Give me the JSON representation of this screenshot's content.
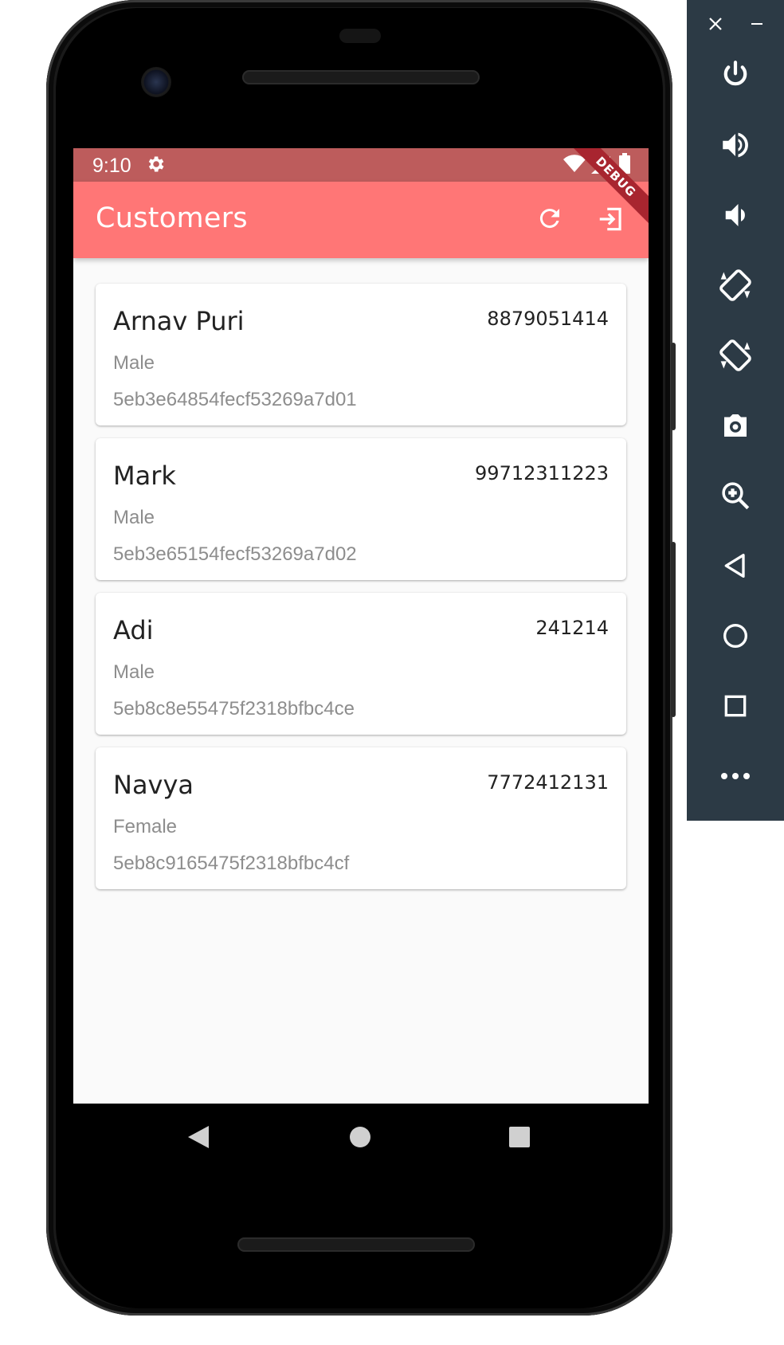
{
  "status_bar": {
    "time": "9:10",
    "debug_label": "DEBUG"
  },
  "app_bar": {
    "title": "Customers"
  },
  "customers": [
    {
      "name": "Arnav Puri",
      "phone": "8879051414",
      "gender": "Male",
      "id": "5eb3e64854fecf53269a7d01"
    },
    {
      "name": "Mark",
      "phone": "99712311223",
      "gender": "Male",
      "id": "5eb3e65154fecf53269a7d02"
    },
    {
      "name": "Adi",
      "phone": "241214",
      "gender": "Male",
      "id": "5eb8c8e55475f2318bfbc4ce"
    },
    {
      "name": "Navya",
      "phone": "7772412131",
      "gender": "Female",
      "id": "5eb8c9165475f2318bfbc4cf"
    }
  ],
  "colors": {
    "status_bar": "#bd5c5c",
    "app_bar": "#ff7676",
    "emulator_panel": "#2c3a45"
  },
  "emulator_controls": [
    "close-icon",
    "minimize-icon",
    "power-icon",
    "volume-up-icon",
    "volume-down-icon",
    "rotate-left-icon",
    "rotate-right-icon",
    "camera-icon",
    "zoom-icon",
    "back-icon",
    "home-icon",
    "overview-icon",
    "more-icon"
  ]
}
